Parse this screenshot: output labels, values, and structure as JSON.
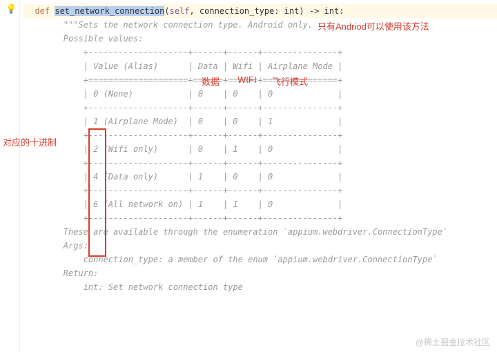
{
  "gutter": {
    "bulb": "💡"
  },
  "def": {
    "keyword": "def ",
    "name_sel": "set_network_connection",
    "params": "(",
    "self": "self",
    "rest": ", connection_type: int) -> int:"
  },
  "doc": {
    "summary": "        \"\"\"Sets the network connection type. Android only.",
    "blank": "",
    "possible": "        Possible values:",
    "table": [
      "            +--------------------+------+------+---------------+",
      "            | Value (Alias)      | Data | Wifi | Airplane Mode |",
      "            +====================+======+======+===============+",
      "            | 0 (None)           | 0    | 0    | 0             |",
      "            +--------------------+------+------+---------------+",
      "            | 1 (Airplane Mode)  | 0    | 0    | 1             |",
      "            +--------------------+------+------+---------------+",
      "            | 2 (Wifi only)      | 0    | 1    | 0             |",
      "            +--------------------+------+------+---------------+",
      "            | 4 (Data only)      | 1    | 0    | 0             |",
      "            +--------------------+------+------+---------------+",
      "            | 6 (All network on) | 1    | 1    | 0             |",
      "            +--------------------+------+------+---------------+"
    ],
    "footer1": "        These are available through the enumeration `appium.webdriver.ConnectionType`",
    "args_h": "        Args:",
    "args_l": "            connection_type: a member of the enum `appium.webdriver.ConnectionType`",
    "ret_h": "        Return:",
    "ret_l": "            int: Set network connection type"
  },
  "annotations": {
    "android_only": "只有Andriod可以使用该方法",
    "data": "数据",
    "wifi": "WIFI",
    "airplane": "飞行模式",
    "decimal": "对应的十进制"
  },
  "watermark": "@稀土掘金技术社区"
}
